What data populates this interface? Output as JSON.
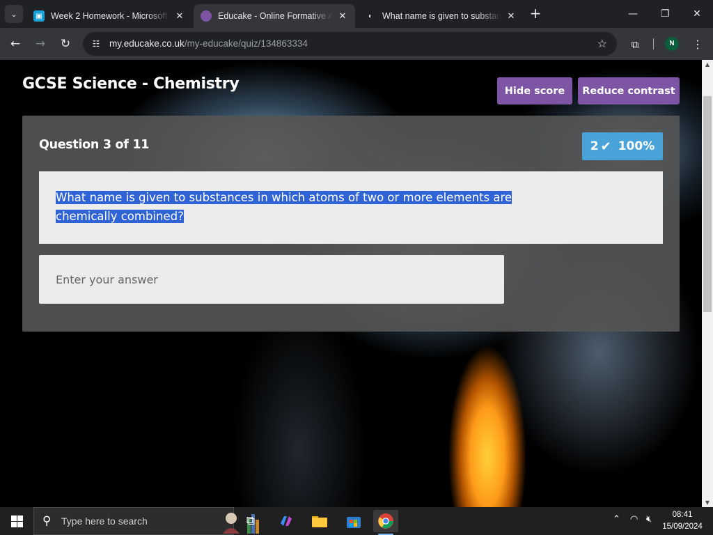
{
  "browser": {
    "tabs": [
      {
        "title": "Week 2 Homework - Microsoft",
        "close": "✕",
        "favicon_color": "#1a9fd9"
      },
      {
        "title": "Educake - Online Formative Assessment",
        "close": "✕",
        "favicon_color": "#7d55a4"
      },
      {
        "title": "What name is given to substances",
        "close": "✕",
        "favicon_color": "#e8eaed"
      }
    ],
    "url_host": "my.educake.co.uk",
    "url_path": "/my-educake/quiz/134863334",
    "profile_initial": "N"
  },
  "page": {
    "title": "GCSE Science - Chemistry",
    "hide_score_label": "Hide score",
    "reduce_contrast_label": "Reduce contrast",
    "question_number": "Question 3 of 11",
    "score_correct": "2",
    "score_percent": "100%",
    "question_text": "What name is given to substances in which atoms of two or more elements are chemically combined?",
    "answer_placeholder": "Enter your answer",
    "answer_value": ""
  },
  "taskbar": {
    "search_placeholder": "Type here to search",
    "time": "08:41",
    "date": "15/09/2024"
  },
  "colors": {
    "accent_purple": "#7d55a4",
    "score_blue": "#4aa3d8",
    "selection_blue": "#2f63d6"
  }
}
